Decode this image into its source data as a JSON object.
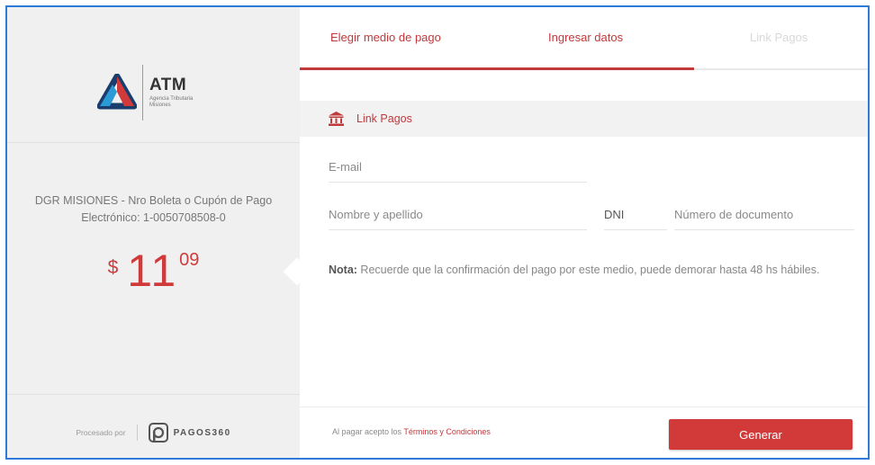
{
  "brand": {
    "name": "ATM",
    "subtitle": "Agencia Tributaria Misiones"
  },
  "payment": {
    "description": "DGR MISIONES - Nro Boleta o Cupón de Pago Electrónico: 1-0050708508-0",
    "currency_symbol": "$",
    "amount_integer": "11",
    "amount_decimal": "09"
  },
  "footer_left": {
    "processed_by": "Procesado por",
    "provider": "PAGOS360"
  },
  "tabs": [
    {
      "label": "Elegir medio de pago",
      "state": "done"
    },
    {
      "label": "Ingresar datos",
      "state": "active"
    },
    {
      "label": "Link Pagos",
      "state": "pending"
    }
  ],
  "progress": 0.69,
  "section": {
    "title": "Link Pagos",
    "icon": "bank-icon"
  },
  "form": {
    "email_placeholder": "E-mail",
    "name_placeholder": "Nombre y apellido",
    "doc_type_value": "DNI",
    "doc_number_placeholder": "Número de documento"
  },
  "note": {
    "label": "Nota:",
    "text": " Recuerde que la confirmación del pago por este medio, puede demorar hasta 48 hs hábiles."
  },
  "footer_right": {
    "terms_prefix": "Al pagar acepto los ",
    "terms_link": "Términos y Condiciones",
    "generate_button": "Generar"
  },
  "colors": {
    "accent": "#c0393b",
    "button": "#d23a3a",
    "frame_border": "#2f7bd8"
  }
}
